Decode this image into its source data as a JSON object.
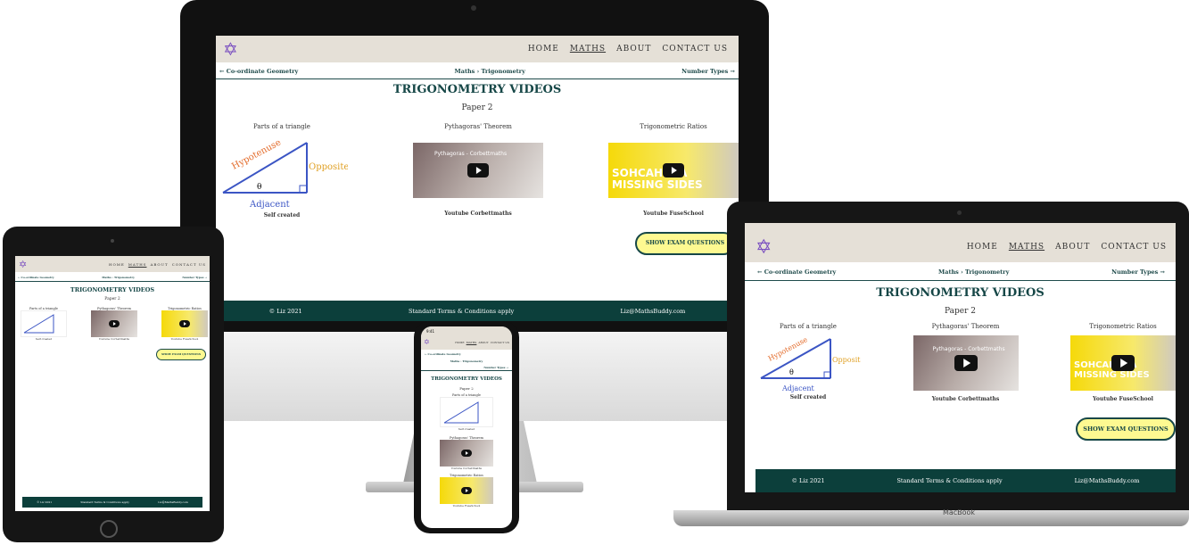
{
  "site": {
    "nav": [
      "HOME",
      "MATHS",
      "ABOUT",
      "CONTACT US"
    ],
    "breadcrumb_prev": "← Co-ordinate Geometry",
    "breadcrumb_mid": "Maths › Trigonometry",
    "breadcrumb_next": "Number Types →",
    "page_title": "TRIGONOMETRY VIDEOS",
    "subtitle": "Paper 2",
    "cards": [
      {
        "title": "Parts of a triangle",
        "caption": "Self created",
        "labels": [
          "Hypotenuse",
          "Opposite",
          "Adjacent",
          "θ"
        ]
      },
      {
        "title": "Pythagoras' Theorem",
        "caption": "Youtube Corbettmaths",
        "overlay": "Pythagoras - Corbettmaths"
      },
      {
        "title": "Trigonometric Ratios",
        "caption": "Youtube FuseSchool",
        "overlay": "SOHCAHTOA - Finding Mis...",
        "big": "SOHCAHTOA MISSING SIDES"
      }
    ],
    "exam_button": "SHOW EXAM QUESTIONS",
    "footer": [
      "© Liz 2021",
      "Standard Terms & Conditions apply",
      "Liz@MathsBuddy.com"
    ],
    "phone_time": "9:41"
  },
  "laptop_label": "MacBook"
}
